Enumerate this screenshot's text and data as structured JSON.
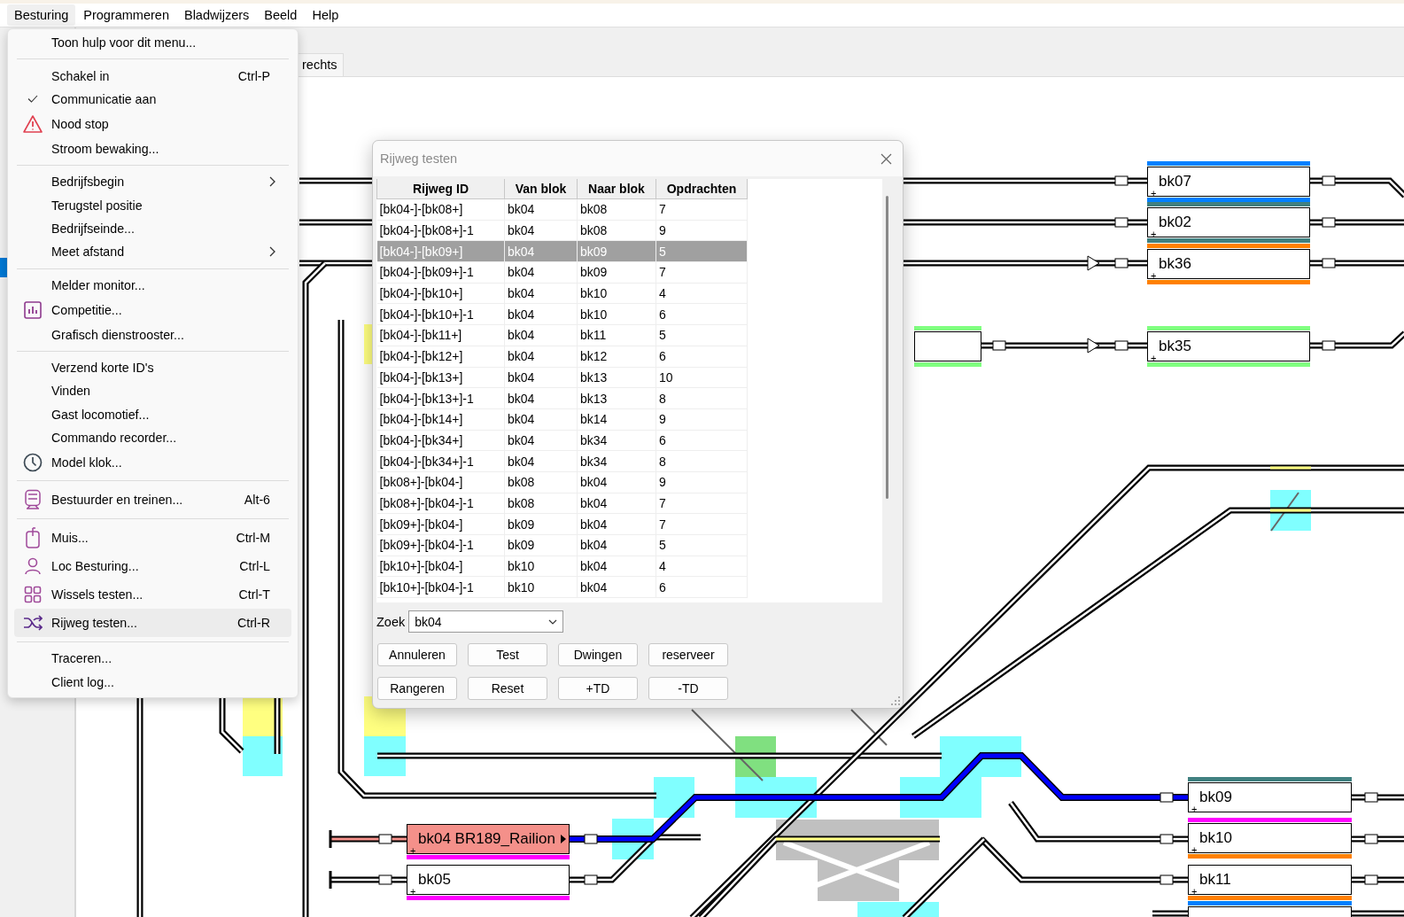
{
  "menubar": [
    {
      "label": "Besturing",
      "selected": true
    },
    {
      "label": "Programmeren",
      "selected": false
    },
    {
      "label": "Bladwijzers",
      "selected": false
    },
    {
      "label": "Beeld",
      "selected": false
    },
    {
      "label": "Help",
      "selected": false
    }
  ],
  "tabs": [
    {
      "label": "rechts"
    }
  ],
  "menu": {
    "items": [
      {
        "kind": "item",
        "label": "Toon hulp voor dit menu...",
        "checked": false,
        "submenu": false,
        "selected": false
      },
      {
        "kind": "separator"
      },
      {
        "kind": "item",
        "label": "Schakel in",
        "shortcut": "Ctrl-P",
        "checked": false,
        "submenu": false,
        "selected": false
      },
      {
        "kind": "item",
        "label": "Communicatie aan",
        "checked": true,
        "submenu": false,
        "selected": false
      },
      {
        "kind": "item",
        "label": "Nood stop",
        "checked": false,
        "submenu": false,
        "selected": false
      },
      {
        "kind": "item",
        "label": "Stroom bewaking...",
        "checked": false,
        "submenu": false,
        "selected": false
      },
      {
        "kind": "separator"
      },
      {
        "kind": "item",
        "label": "Bedrijfsbegin",
        "checked": false,
        "submenu": true,
        "selected": false
      },
      {
        "kind": "item",
        "label": "Terugstel positie",
        "checked": false,
        "submenu": false,
        "selected": false
      },
      {
        "kind": "item",
        "label": "Bedrijfseinde...",
        "checked": false,
        "submenu": false,
        "selected": false
      },
      {
        "kind": "item",
        "label": "Meet afstand",
        "checked": false,
        "submenu": true,
        "selected": false
      },
      {
        "kind": "separator"
      },
      {
        "kind": "item",
        "label": "Melder monitor...",
        "checked": false,
        "submenu": false,
        "selected": false
      },
      {
        "kind": "item",
        "label": "Competitie...",
        "checked": false,
        "submenu": false,
        "selected": false
      },
      {
        "kind": "item",
        "label": "Grafisch dienstrooster...",
        "checked": false,
        "submenu": false,
        "selected": false
      },
      {
        "kind": "separator"
      },
      {
        "kind": "item",
        "label": "Verzend korte ID's",
        "checked": false,
        "submenu": false,
        "selected": false
      },
      {
        "kind": "item",
        "label": "Vinden",
        "checked": false,
        "submenu": false,
        "selected": false
      },
      {
        "kind": "item",
        "label": "Gast locomotief...",
        "checked": false,
        "submenu": false,
        "selected": false
      },
      {
        "kind": "item",
        "label": "Commando recorder...",
        "checked": false,
        "submenu": false,
        "selected": false
      },
      {
        "kind": "item",
        "label": "Model klok...",
        "checked": false,
        "submenu": false,
        "selected": false
      },
      {
        "kind": "separator"
      },
      {
        "kind": "item",
        "label": "Bestuurder en treinen...",
        "shortcut": "Alt-6",
        "checked": false,
        "submenu": false,
        "selected": false
      },
      {
        "kind": "separator"
      },
      {
        "kind": "item",
        "label": "Muis...",
        "shortcut": "Ctrl-M",
        "checked": false,
        "submenu": false,
        "selected": false
      },
      {
        "kind": "item",
        "label": "Loc Besturing...",
        "shortcut": "Ctrl-L",
        "checked": false,
        "submenu": false,
        "selected": false
      },
      {
        "kind": "item",
        "label": "Wissels testen...",
        "shortcut": "Ctrl-T",
        "checked": false,
        "submenu": false,
        "selected": false
      },
      {
        "kind": "item",
        "label": "Rijweg testen...",
        "shortcut": "Ctrl-R",
        "checked": false,
        "submenu": false,
        "selected": true
      },
      {
        "kind": "separator"
      },
      {
        "kind": "item",
        "label": "Traceren...",
        "checked": false,
        "submenu": false,
        "selected": false
      },
      {
        "kind": "item",
        "label": "Client log...",
        "checked": false,
        "submenu": false,
        "selected": false
      }
    ]
  },
  "blocks": [
    {
      "label": "bk07",
      "corner_mark": "+",
      "bars": [
        {
          "kind": "top",
          "color": "#0080ff"
        },
        {
          "kind": "bottom",
          "color": "#0080ff"
        }
      ],
      "occupied": false
    },
    {
      "label": "bk02",
      "corner_mark": "+",
      "bars": [
        {
          "kind": "top",
          "color": "#408080"
        },
        {
          "kind": "bottom",
          "color": "#408080"
        }
      ],
      "occupied": false
    },
    {
      "label": "bk36",
      "corner_mark": "+",
      "bars": [
        {
          "kind": "top",
          "color": "#ff8000"
        },
        {
          "kind": "bottom",
          "color": "#ff8000"
        }
      ],
      "occupied": false
    },
    {
      "bars": [
        {
          "kind": "top",
          "color": "#80ff80"
        },
        {
          "kind": "bottom",
          "color": "#80ff80"
        }
      ],
      "occupied": false
    },
    {
      "label": "bk35",
      "corner_mark": "+",
      "bars": [
        {
          "kind": "top",
          "color": "#80ff80"
        },
        {
          "kind": "bottom",
          "color": "#80ff80"
        }
      ],
      "occupied": false
    },
    {
      "label": "bk09",
      "corner_mark": "+",
      "bars": [
        {
          "kind": "top",
          "color": "#408080"
        }
      ],
      "occupied": false
    },
    {
      "label": "bk04 BR189_Railion",
      "corner_mark": "+",
      "bars": [
        {
          "kind": "bottom",
          "color": "#ff00ff"
        }
      ],
      "occupied": true
    },
    {
      "label": "bk10",
      "corner_mark": "+",
      "bars": [
        {
          "kind": "top",
          "color": "#ff00ff"
        },
        {
          "kind": "bottom",
          "color": "#ff8000"
        }
      ],
      "occupied": false
    },
    {
      "label": "bk05",
      "corner_mark": "+",
      "bars": [
        {
          "kind": "bottom",
          "color": "#ff00ff"
        }
      ],
      "occupied": false
    },
    {
      "label": "bk11",
      "corner_mark": "+",
      "bars": [
        {
          "kind": "bottom",
          "color": "#ff8000"
        }
      ],
      "occupied": false
    },
    {
      "bars": [
        {
          "kind": "top",
          "color": "#0080ff"
        }
      ],
      "occupied": false
    }
  ],
  "dialog": {
    "title": "Rijweg testen",
    "table": {
      "columns": [
        "Rijweg ID",
        "Van blok",
        "Naar blok",
        "Opdrachten"
      ],
      "rows": [
        {
          "cells": [
            "[bk04-]-[bk08+]",
            "bk04",
            "bk08",
            "7"
          ],
          "selected": false
        },
        {
          "cells": [
            "[bk04-]-[bk08+]-1",
            "bk04",
            "bk08",
            "9"
          ],
          "selected": false
        },
        {
          "cells": [
            "[bk04-]-[bk09+]",
            "bk04",
            "bk09",
            "5"
          ],
          "selected": true
        },
        {
          "cells": [
            "[bk04-]-[bk09+]-1",
            "bk04",
            "bk09",
            "7"
          ],
          "selected": false
        },
        {
          "cells": [
            "[bk04-]-[bk10+]",
            "bk04",
            "bk10",
            "4"
          ],
          "selected": false
        },
        {
          "cells": [
            "[bk04-]-[bk10+]-1",
            "bk04",
            "bk10",
            "6"
          ],
          "selected": false
        },
        {
          "cells": [
            "[bk04-]-[bk11+]",
            "bk04",
            "bk11",
            "5"
          ],
          "selected": false
        },
        {
          "cells": [
            "[bk04-]-[bk12+]",
            "bk04",
            "bk12",
            "6"
          ],
          "selected": false
        },
        {
          "cells": [
            "[bk04-]-[bk13+]",
            "bk04",
            "bk13",
            "10"
          ],
          "selected": false
        },
        {
          "cells": [
            "[bk04-]-[bk13+]-1",
            "bk04",
            "bk13",
            "8"
          ],
          "selected": false
        },
        {
          "cells": [
            "[bk04-]-[bk14+]",
            "bk04",
            "bk14",
            "9"
          ],
          "selected": false
        },
        {
          "cells": [
            "[bk04-]-[bk34+]",
            "bk04",
            "bk34",
            "6"
          ],
          "selected": false
        },
        {
          "cells": [
            "[bk04-]-[bk34+]-1",
            "bk04",
            "bk34",
            "8"
          ],
          "selected": false
        },
        {
          "cells": [
            "[bk08+]-[bk04-]",
            "bk08",
            "bk04",
            "9"
          ],
          "selected": false
        },
        {
          "cells": [
            "[bk08+]-[bk04-]-1",
            "bk08",
            "bk04",
            "7"
          ],
          "selected": false
        },
        {
          "cells": [
            "[bk09+]-[bk04-]",
            "bk09",
            "bk04",
            "7"
          ],
          "selected": false
        },
        {
          "cells": [
            "[bk09+]-[bk04-]-1",
            "bk09",
            "bk04",
            "5"
          ],
          "selected": false
        },
        {
          "cells": [
            "[bk10+]-[bk04-]",
            "bk10",
            "bk04",
            "4"
          ],
          "selected": false
        },
        {
          "cells": [
            "[bk10+]-[bk04-]-1",
            "bk10",
            "bk04",
            "6"
          ],
          "selected": false
        }
      ]
    },
    "search": {
      "label": "Zoek",
      "value": "bk04"
    },
    "buttons": [
      "Annuleren",
      "Test",
      "Dwingen",
      "reserveer",
      "Rangeren",
      "Reset",
      "+TD",
      "-TD"
    ]
  }
}
